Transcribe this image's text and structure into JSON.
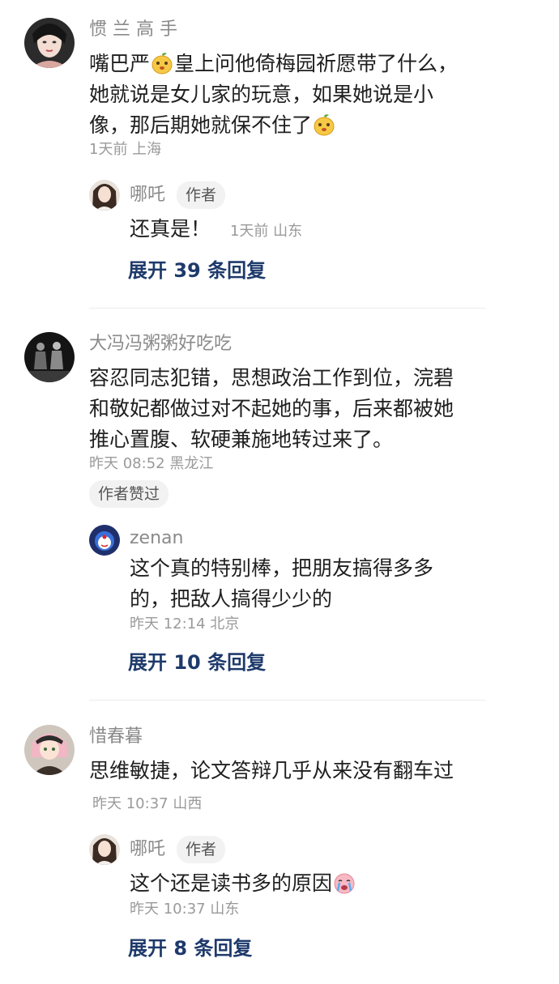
{
  "comments": [
    {
      "username": "惯 兰 高 手",
      "text_parts": [
        "嘴巴严",
        "皇上问他倚梅园祈愿带了什么，她就说是女儿家的玩意，如果她说是小像，那后期她就保不住了"
      ],
      "meta": "1天前 上海",
      "reply": {
        "username": "哪吒",
        "badge": "作者",
        "text": "还真是！",
        "meta": "1天前 山东"
      },
      "expand": "展开 39 条回复"
    },
    {
      "username": "大冯冯粥粥好吃吃",
      "text": "容忍同志犯错，思想政治工作到位，浣碧和敬妃都做过对不起她的事，后来都被她推心置腹、软硬兼施地转过来了。",
      "meta": "昨天 08:52 黑龙江",
      "liked_badge": "作者赞过",
      "reply": {
        "username": "zenan",
        "text": "这个真的特别棒，把朋友搞得多多的，把敌人搞得少少的",
        "meta": "昨天 12:14 北京"
      },
      "expand": "展开 10 条回复"
    },
    {
      "username": "惜春暮",
      "text": "思维敏捷，论文答辩几乎从来没有翻车过",
      "meta": "昨天 10:37 山西",
      "reply": {
        "username": "哪吒",
        "badge": "作者",
        "text": "这个还是读书多的原因",
        "meta": "昨天 10:37 山东"
      },
      "expand": "展开 8 条回复"
    }
  ],
  "icons": {
    "emoji_smirk": "mango-smirk-emoji",
    "emoji_cry": "crying-emoji"
  }
}
